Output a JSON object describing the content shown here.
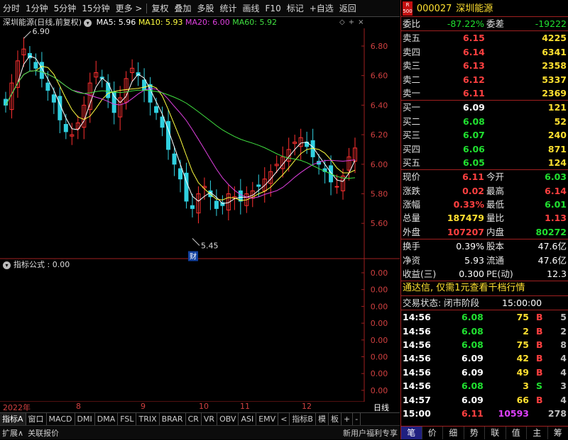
{
  "toolbar": {
    "items": [
      "分时",
      "1分钟",
      "5分钟",
      "15分钟",
      "更多 >",
      "复权",
      "叠加",
      "多股",
      "统计",
      "画线",
      "F10",
      "标记",
      "+自选",
      "返回"
    ]
  },
  "chart": {
    "title": "深圳能源(日线,前复权)",
    "ma5": "MA5: 5.96",
    "ma10": "MA10: 5.93",
    "ma20": "MA20: 6.00",
    "ma60": "MA60: 5.92",
    "high_label": "6.90",
    "low_label": "5.45",
    "fin_label": "财",
    "ytick": [
      "6.80",
      "6.60",
      "6.40",
      "6.20",
      "6.00",
      "5.80",
      "5.60"
    ],
    "ind_ytick": [
      "0.00",
      "0.00",
      "0.00",
      "0.00",
      "0.00",
      "0.00",
      "0.00",
      "0.00"
    ]
  },
  "indicator": {
    "label": "指标公式 : 0.00"
  },
  "dates": {
    "year": "2022年",
    "m8": "8",
    "m9": "9",
    "m10": "10",
    "m11": "11",
    "m12": "12",
    "right": "日线"
  },
  "tabs": [
    "指标A",
    "窗口",
    "MACD",
    "DMI",
    "DMA",
    "FSL",
    "TRIX",
    "BRAR",
    "CR",
    "VR",
    "OBV",
    "ASI",
    "EMV",
    "<",
    "指标B",
    "模",
    "板",
    "+",
    "-"
  ],
  "statusbar": {
    "left1": "扩展∧",
    "left2": "关联报价",
    "right": "新用户福利专享"
  },
  "stock": {
    "code": "000027",
    "name": "深圳能源",
    "badge_r": "R",
    "badge_n": "500"
  },
  "weibi": {
    "label": "委比",
    "val": "-87.22%",
    "label2": "委差",
    "val2": "-19222"
  },
  "asks": [
    {
      "label": "卖五",
      "price": "6.15",
      "vol": "4225"
    },
    {
      "label": "卖四",
      "price": "6.14",
      "vol": "6341"
    },
    {
      "label": "卖三",
      "price": "6.13",
      "vol": "2358"
    },
    {
      "label": "卖二",
      "price": "6.12",
      "vol": "5337"
    },
    {
      "label": "卖一",
      "price": "6.11",
      "vol": "2369"
    }
  ],
  "bids": [
    {
      "label": "买一",
      "price": "6.09",
      "vol": "121",
      "c": "white"
    },
    {
      "label": "买二",
      "price": "6.08",
      "vol": "52",
      "c": "green"
    },
    {
      "label": "买三",
      "price": "6.07",
      "vol": "240",
      "c": "green"
    },
    {
      "label": "买四",
      "price": "6.06",
      "vol": "871",
      "c": "green"
    },
    {
      "label": "买五",
      "price": "6.05",
      "vol": "124",
      "c": "green"
    }
  ],
  "quote": [
    {
      "l1": "现价",
      "v1": "6.11",
      "c1": "red",
      "l2": "今开",
      "v2": "6.03",
      "c2": "green"
    },
    {
      "l1": "涨跌",
      "v1": "0.02",
      "c1": "red",
      "l2": "最高",
      "v2": "6.14",
      "c2": "red"
    },
    {
      "l1": "涨幅",
      "v1": "0.33%",
      "c1": "red",
      "l2": "最低",
      "v2": "6.01",
      "c2": "green"
    },
    {
      "l1": "总量",
      "v1": "187479",
      "c1": "yellow",
      "l2": "量比",
      "v2": "1.13",
      "c2": "red"
    },
    {
      "l1": "外盘",
      "v1": "107207",
      "c1": "red",
      "l2": "内盘",
      "v2": "80272",
      "c2": "green"
    }
  ],
  "fund": [
    {
      "l1": "换手",
      "v1": "0.39%",
      "l2": "股本",
      "v2": "47.6亿"
    },
    {
      "l1": "净资",
      "v1": "5.93",
      "l2": "流通",
      "v2": "47.6亿"
    },
    {
      "l1": "收益(三)",
      "v1": "0.300",
      "l2": "PE(动)",
      "v2": "12.3"
    }
  ],
  "promo": "通达信, 仅需1元查看千档行情",
  "trade_status": {
    "label": "交易状态: 闭市阶段",
    "time": "15:00:00"
  },
  "trades": [
    {
      "t": "14:56",
      "p": "6.08",
      "pc": "green",
      "v": "75",
      "bs": "B",
      "bc": "red",
      "n": "5"
    },
    {
      "t": "14:56",
      "p": "6.08",
      "pc": "green",
      "v": "2",
      "bs": "B",
      "bc": "red",
      "n": "2"
    },
    {
      "t": "14:56",
      "p": "6.08",
      "pc": "green",
      "v": "75",
      "bs": "B",
      "bc": "red",
      "n": "8"
    },
    {
      "t": "14:56",
      "p": "6.09",
      "pc": "white",
      "v": "42",
      "bs": "B",
      "bc": "red",
      "n": "4"
    },
    {
      "t": "14:56",
      "p": "6.09",
      "pc": "white",
      "v": "49",
      "bs": "B",
      "bc": "red",
      "n": "4"
    },
    {
      "t": "14:56",
      "p": "6.08",
      "pc": "green",
      "v": "3",
      "bs": "S",
      "bc": "green",
      "n": "3"
    },
    {
      "t": "14:57",
      "p": "6.09",
      "pc": "white",
      "v": "66",
      "bs": "B",
      "bc": "red",
      "n": "4"
    },
    {
      "t": "15:00",
      "p": "6.11",
      "pc": "red",
      "v": "10593",
      "vc": "purple",
      "bs": "",
      "bc": "red",
      "n": "278"
    }
  ],
  "bottom_tabs": [
    "笔",
    "价",
    "细",
    "势",
    "联",
    "值",
    "主",
    "筹"
  ],
  "colors": {
    "up": "#ff3030",
    "down": "#30d0e0",
    "ma5": "#ffffff",
    "ma10": "#ffff40",
    "ma20": "#e040e0",
    "ma60": "#40e040",
    "frame": "#a02020"
  }
}
